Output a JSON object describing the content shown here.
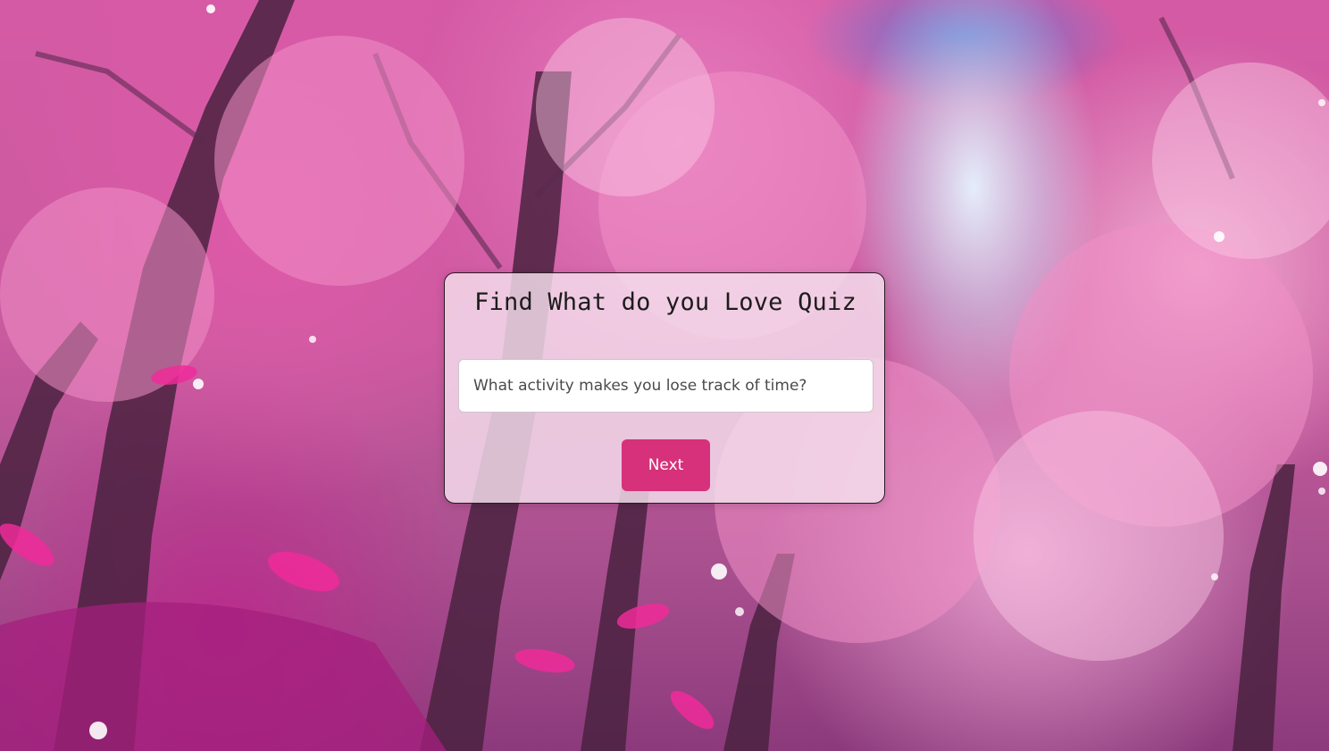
{
  "quiz": {
    "title": "Find What do you Love Quiz",
    "question_placeholder": "What activity makes you lose track of time?",
    "answer_value": "",
    "next_label": "Next"
  },
  "colors": {
    "accent_button": "#d6317a",
    "card_background": "rgba(245,225,238,0.82)",
    "card_border": "#2a1a24"
  },
  "background": {
    "scene": "pink-blossom-forest-with-waterfall"
  }
}
